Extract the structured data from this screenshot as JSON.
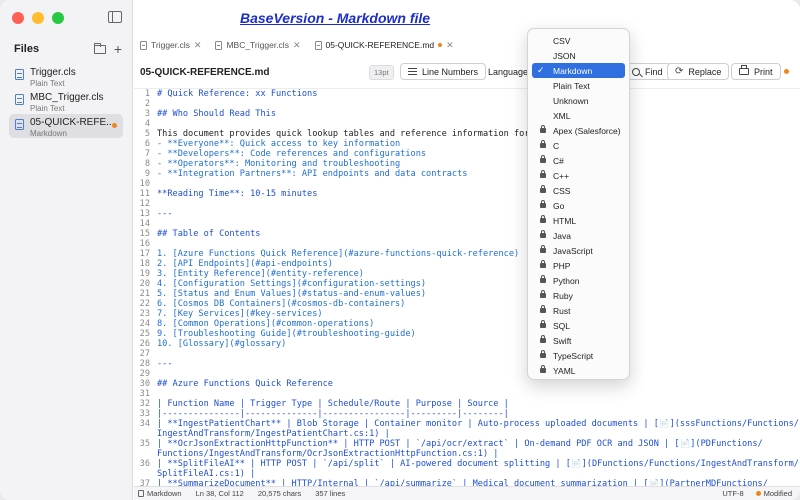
{
  "sidebar": {
    "title": "Files",
    "files": [
      {
        "name": "Trigger.cls",
        "type": "Plain Text",
        "active": false,
        "modified": false
      },
      {
        "name": "MBC_Trigger.cls",
        "type": "Plain Text",
        "active": false,
        "modified": false
      },
      {
        "name": "05-QUICK-REFE...",
        "type": "Markdown",
        "active": true,
        "modified": true
      }
    ]
  },
  "banner": "BaseVersion - Markdown file",
  "tabs": [
    {
      "label": "Trigger.cls"
    },
    {
      "label": "MBC_Trigger.cls"
    },
    {
      "label": "05-QUICK-REFERENCE.md"
    }
  ],
  "toolbar": {
    "doc_title": "05-QUICK-REFERENCE.md",
    "font_size": "13pt",
    "line_numbers_label": "Line Numbers",
    "language_label": "Language",
    "find_label": "Find",
    "replace_label": "Replace",
    "print_label": "Print"
  },
  "language_menu": {
    "selected": "Markdown",
    "items": [
      {
        "label": "CSV",
        "locked": false
      },
      {
        "label": "JSON",
        "locked": false
      },
      {
        "label": "Markdown",
        "locked": false
      },
      {
        "label": "Plain Text",
        "locked": false
      },
      {
        "label": "Unknown",
        "locked": false
      },
      {
        "label": "XML",
        "locked": false
      },
      {
        "label": "Apex (Salesforce)",
        "locked": true
      },
      {
        "label": "C",
        "locked": true
      },
      {
        "label": "C#",
        "locked": true
      },
      {
        "label": "C++",
        "locked": true
      },
      {
        "label": "CSS",
        "locked": true
      },
      {
        "label": "Go",
        "locked": true
      },
      {
        "label": "HTML",
        "locked": true
      },
      {
        "label": "Java",
        "locked": true
      },
      {
        "label": "JavaScript",
        "locked": true
      },
      {
        "label": "PHP",
        "locked": true
      },
      {
        "label": "Python",
        "locked": true
      },
      {
        "label": "Ruby",
        "locked": true
      },
      {
        "label": "Rust",
        "locked": true
      },
      {
        "label": "SQL",
        "locked": true
      },
      {
        "label": "Swift",
        "locked": true
      },
      {
        "label": "TypeScript",
        "locked": true
      },
      {
        "label": "YAML",
        "locked": true
      }
    ]
  },
  "editor": {
    "lines": [
      {
        "n": "1",
        "text": "# Quick Reference: xx Functions",
        "kind": "heading"
      },
      {
        "n": "2",
        "text": "",
        "kind": "text"
      },
      {
        "n": "3",
        "text": "## Who Should Read This",
        "kind": "heading"
      },
      {
        "n": "4",
        "text": "",
        "kind": "text"
      },
      {
        "n": "5",
        "text": "This document provides quick lookup tables and reference information for:",
        "kind": "text"
      },
      {
        "n": "6",
        "text": "- **Everyone**: Quick access to key information",
        "kind": "list"
      },
      {
        "n": "7",
        "text": "- **Developers**: Code references and configurations",
        "kind": "list"
      },
      {
        "n": "8",
        "text": "- **Operators**: Monitoring and troubleshooting",
        "kind": "list"
      },
      {
        "n": "9",
        "text": "- **Integration Partners**: API endpoints and data contracts",
        "kind": "list"
      },
      {
        "n": "10",
        "text": "",
        "kind": "text"
      },
      {
        "n": "11",
        "text": "**Reading Time**: 10-15 minutes",
        "kind": "bold"
      },
      {
        "n": "12",
        "text": "",
        "kind": "text"
      },
      {
        "n": "13",
        "text": "---",
        "kind": "heading"
      },
      {
        "n": "14",
        "text": "",
        "kind": "text"
      },
      {
        "n": "15",
        "text": "## Table of Contents",
        "kind": "heading"
      },
      {
        "n": "16",
        "text": "",
        "kind": "text"
      },
      {
        "n": "17",
        "text": "1. [Azure Functions Quick Reference](#azure-functions-quick-reference)",
        "kind": "link"
      },
      {
        "n": "18",
        "text": "2. [API Endpoints](#api-endpoints)",
        "kind": "link"
      },
      {
        "n": "19",
        "text": "3. [Entity Reference](#entity-reference)",
        "kind": "link"
      },
      {
        "n": "20",
        "text": "4. [Configuration Settings](#configuration-settings)",
        "kind": "link"
      },
      {
        "n": "21",
        "text": "5. [Status and Enum Values](#status-and-enum-values)",
        "kind": "link"
      },
      {
        "n": "22",
        "text": "6. [Cosmos DB Containers](#cosmos-db-containers)",
        "kind": "link"
      },
      {
        "n": "23",
        "text": "7. [Key Services](#key-services)",
        "kind": "link"
      },
      {
        "n": "24",
        "text": "8. [Common Operations](#common-operations)",
        "kind": "link"
      },
      {
        "n": "25",
        "text": "9. [Troubleshooting Guide](#troubleshooting-guide)",
        "kind": "link"
      },
      {
        "n": "26",
        "text": "10. [Glossary](#glossary)",
        "kind": "link"
      },
      {
        "n": "27",
        "text": "",
        "kind": "text"
      },
      {
        "n": "28",
        "text": "---",
        "kind": "heading"
      },
      {
        "n": "29",
        "text": "",
        "kind": "text"
      },
      {
        "n": "30",
        "text": "## Azure Functions Quick Reference",
        "kind": "heading"
      },
      {
        "n": "31",
        "text": "",
        "kind": "text"
      },
      {
        "n": "32",
        "text": "| Function Name | Trigger Type | Schedule/Route | Purpose | Source |",
        "kind": "table"
      },
      {
        "n": "33",
        "text": "|---------------|--------------|----------------|---------|--------|",
        "kind": "table"
      },
      {
        "n": "34",
        "text": "| **IngestPatientChart** | Blob Storage | Container monitor | Auto-process uploaded documents | [📄](sssFunctions/Functions/",
        "kind": "table"
      },
      {
        "n": "",
        "text": "IngestAndTransform/IngestPatientChart.cs:1) |",
        "kind": "table"
      },
      {
        "n": "35",
        "text": "| **OcrJsonExtractionHttpFunction** | HTTP POST | `/api/ocr/extract` | On-demand PDF OCR and JSON | [📄](PDFunctions/",
        "kind": "table"
      },
      {
        "n": "",
        "text": "Functions/IngestAndTransform/OcrJsonExtractionHttpFunction.cs:1) |",
        "kind": "table"
      },
      {
        "n": "36",
        "text": "| **SplitFileAI** | HTTP POST | `/api/split` | AI-powered document splitting | [📄](DFunctions/Functions/IngestAndTransform/",
        "kind": "table"
      },
      {
        "n": "",
        "text": "SplitFileAI.cs:1) |",
        "kind": "table"
      },
      {
        "n": "37",
        "text": "| **SummarizeDocument** | HTTP/Internal | `/api/summarize` | Medical document summarization | [📄](PartnerMDFunctions/",
        "kind": "table"
      }
    ]
  },
  "statusbar": {
    "language": "Markdown",
    "position": "Ln 38, Col 112",
    "chars": "20,575 chars",
    "lines": "357 lines",
    "encoding": "UTF-8",
    "state": "Modified"
  },
  "colors": {
    "accent": "#2f6fe0",
    "modified_dot": "#f0861a",
    "banner": "#1b2ec9"
  }
}
